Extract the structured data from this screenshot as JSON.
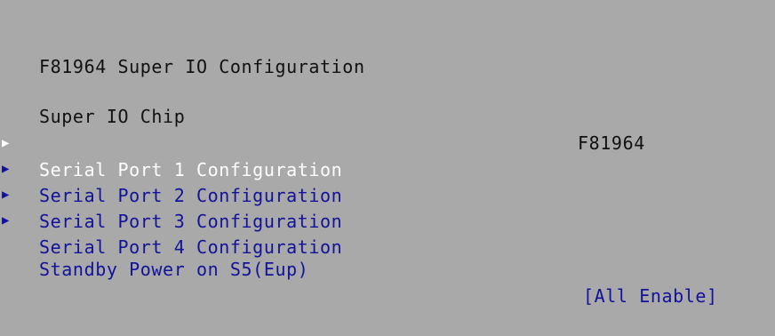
{
  "page": {
    "title": "F81964 Super IO Configuration"
  },
  "info": {
    "label": "Super IO Chip",
    "value": "F81964"
  },
  "submenu_arrow": "▶",
  "menu_items": [
    {
      "label": "Serial Port 1 Configuration",
      "selected": true
    },
    {
      "label": "Serial Port 2 Configuration",
      "selected": false
    },
    {
      "label": "Serial Port 3 Configuration",
      "selected": false
    },
    {
      "label": "Serial Port 4 Configuration",
      "selected": false
    }
  ],
  "standby_option": {
    "label": "Standby Power on S5(Eup)",
    "value": "[All Enable]"
  },
  "colors": {
    "background": "#a9a9a9",
    "static_text": "#111111",
    "selected_text": "#ffffff",
    "interactive_text": "#12129a"
  }
}
